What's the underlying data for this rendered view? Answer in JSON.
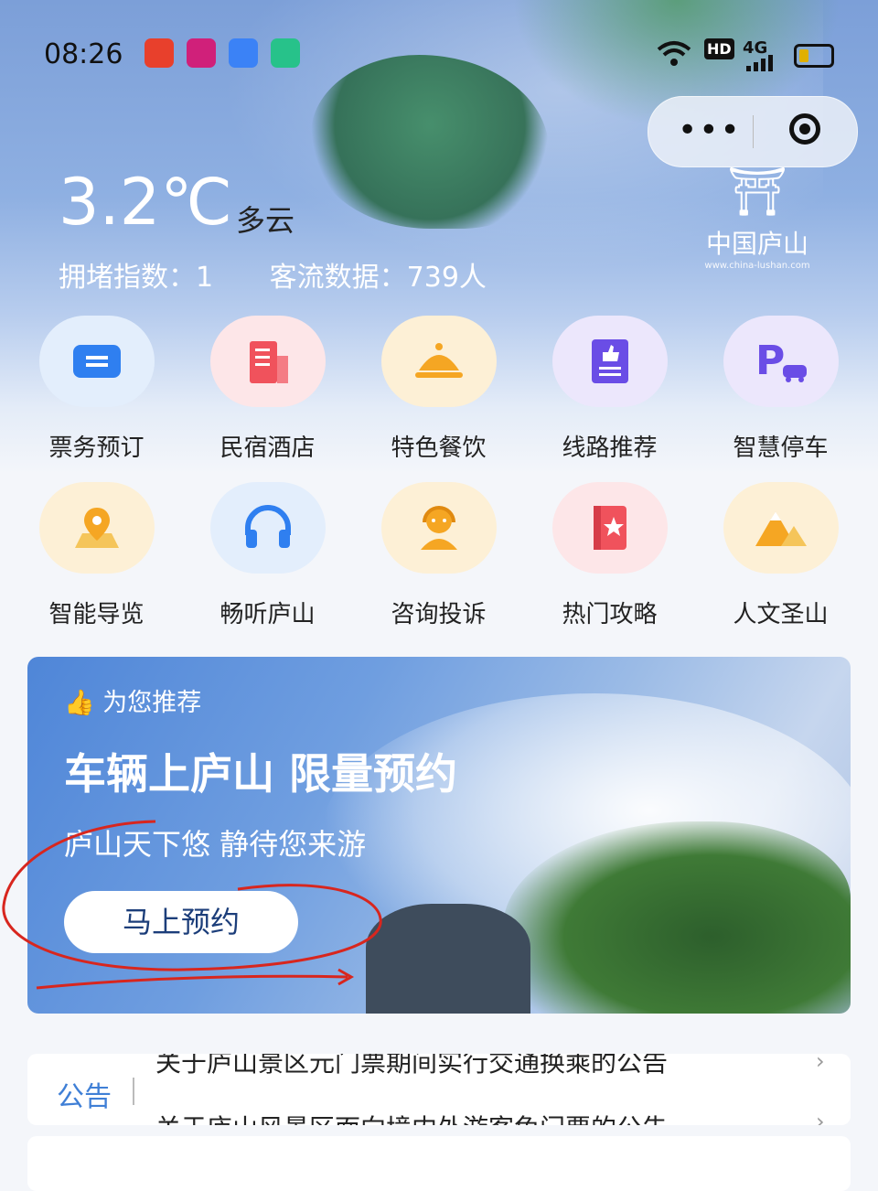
{
  "status": {
    "time": "08:26",
    "sys_hd": "HD",
    "sys_net": "4G"
  },
  "weather": {
    "temperature": "3.2℃",
    "condition": "多云",
    "congestion": "拥堵指数：1",
    "visitors": "客流数据：739人"
  },
  "logo": {
    "name": "中国庐山",
    "url": "www.china-lushan.com"
  },
  "services": [
    {
      "label": "票务预订",
      "icon": "ticket-icon",
      "color": "#2f7ff0"
    },
    {
      "label": "民宿酒店",
      "icon": "hotel-icon",
      "color": "#f0525c"
    },
    {
      "label": "特色餐饮",
      "icon": "dining-cloche-icon",
      "color": "#f5a623"
    },
    {
      "label": "线路推荐",
      "icon": "thumbs-up-book-icon",
      "color": "#6a4de6"
    },
    {
      "label": "智慧停车",
      "icon": "parking-icon",
      "color": "#6a4de6"
    },
    {
      "label": "智能导览",
      "icon": "map-pin-icon",
      "color": "#f5a623"
    },
    {
      "label": "畅听庐山",
      "icon": "headphones-icon",
      "color": "#2f7ff0"
    },
    {
      "label": "咨询投诉",
      "icon": "customer-service-icon",
      "color": "#f5a623"
    },
    {
      "label": "热门攻略",
      "icon": "guide-book-icon",
      "color": "#f0525c"
    },
    {
      "label": "人文圣山",
      "icon": "mountain-icon",
      "color": "#f5a623"
    }
  ],
  "recommend": {
    "tag": "为您推荐",
    "title": "车辆上庐山 限量预约",
    "subtitle": "庐山天下悠 静待您来游",
    "button": "马上预约"
  },
  "notice": {
    "tag": "公告",
    "items": [
      "关于庐山景区元门票期间实行交通换乘的公告",
      "关于庐山风景区面向境内外游客免门票的公告"
    ]
  }
}
